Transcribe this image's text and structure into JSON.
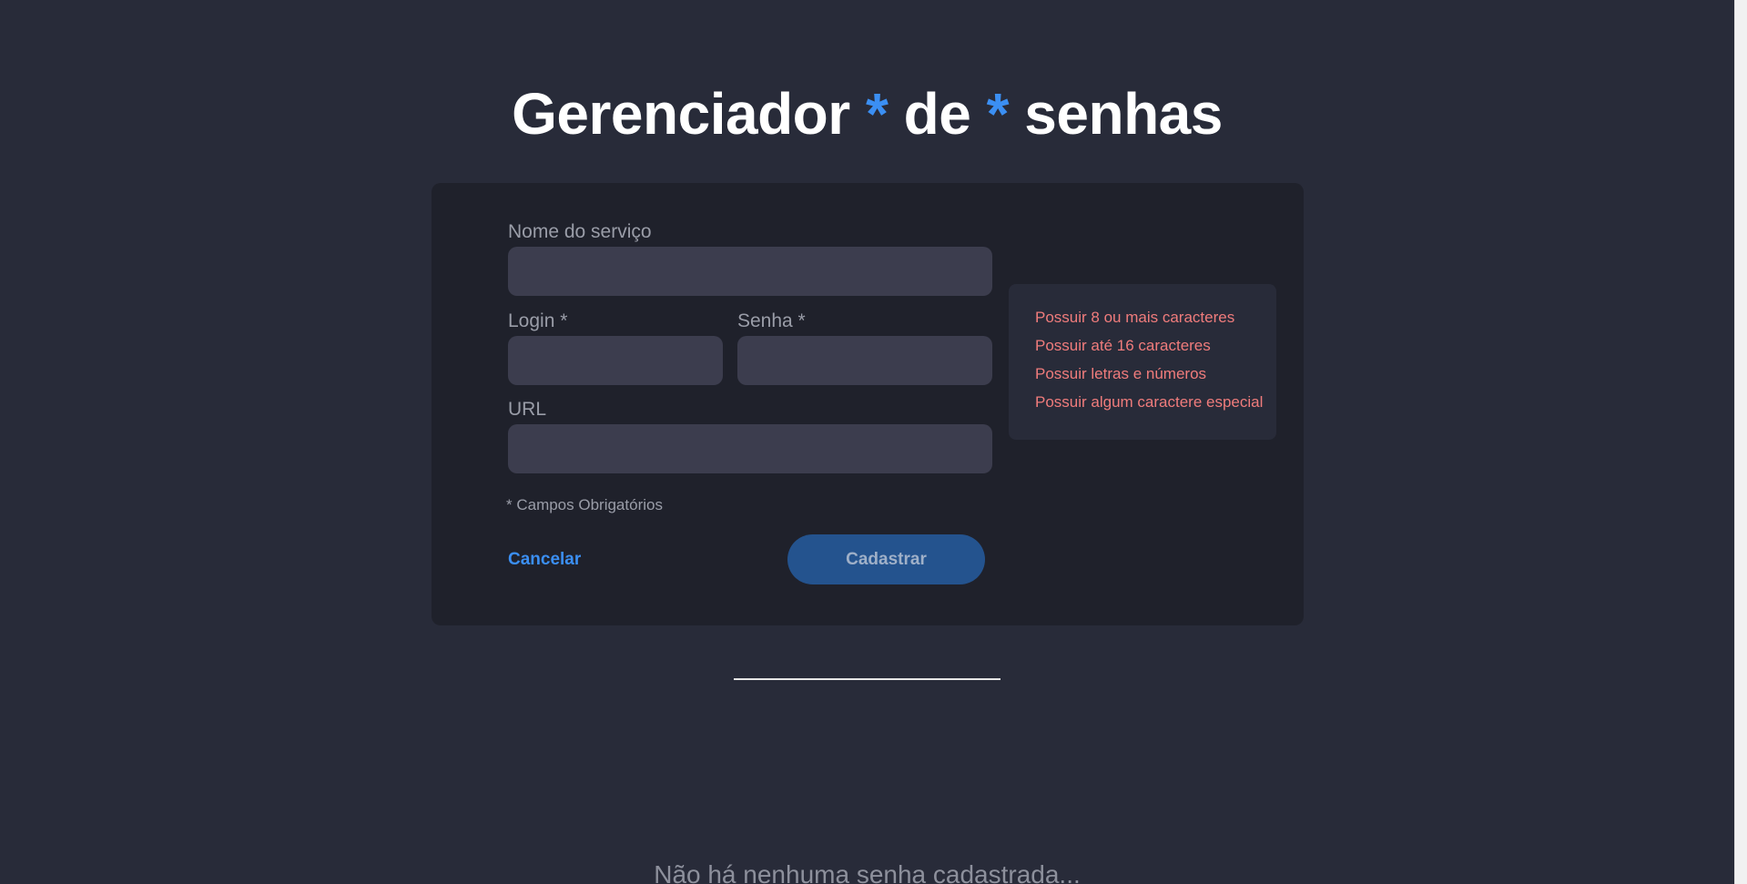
{
  "header": {
    "title_word_1": "Gerenciador",
    "title_star_1": "*",
    "title_word_2": "de",
    "title_star_2": "*",
    "title_word_3": "senhas"
  },
  "form": {
    "service_label": "Nome do serviço",
    "service_value": "",
    "login_label": "Login *",
    "login_value": "",
    "password_label": "Senha *",
    "password_value": "",
    "url_label": "URL",
    "url_value": "",
    "required_note": "* Campos Obrigatórios",
    "cancel_label": "Cancelar",
    "submit_label": "Cadastrar"
  },
  "password_rules": [
    "Possuir 8 ou mais caracteres",
    "Possuir até 16 caracteres",
    "Possuir letras e números",
    "Possuir algum caractere especial"
  ],
  "empty_state": "Não há nenhuma senha cadastrada...",
  "colors": {
    "background": "#282b39",
    "card": "#1f212b",
    "accent": "#3b8ff3",
    "rule_invalid": "#f07c7c",
    "submit_button": "#24538e"
  }
}
